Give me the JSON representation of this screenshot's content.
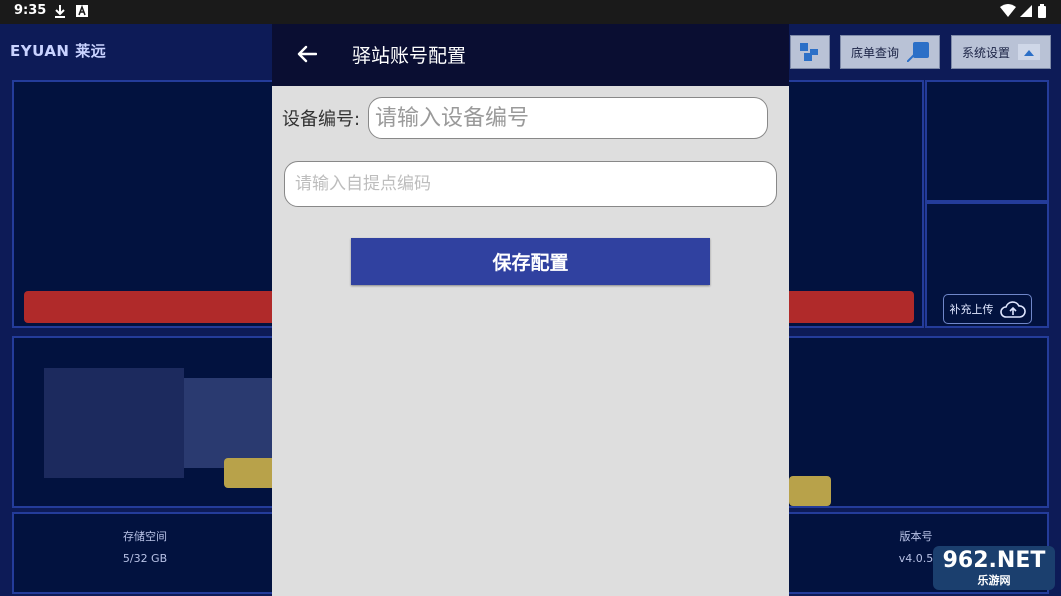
{
  "status_bar": {
    "time": "9:35",
    "icons": [
      "download-icon",
      "a-badge-icon",
      "wifi-icon",
      "signal-icon",
      "battery-icon"
    ]
  },
  "app": {
    "logo_text": "EYUAN 莱远",
    "top_buttons": [
      {
        "label": "",
        "icon": "grid-icon"
      },
      {
        "label": "底单查询",
        "icon": "query-icon"
      },
      {
        "label": "系统设置",
        "icon": "settings-icon"
      }
    ],
    "upload_label": "补充上传",
    "stats": [
      {
        "label": "存储空间",
        "value": "5/32 GB"
      },
      {
        "label": "版本号",
        "value": "v4.0.5"
      }
    ],
    "watermark": {
      "top": "962.NET",
      "bottom": "乐游网"
    }
  },
  "modal": {
    "title": "驿站账号配置",
    "device_label": "设备编号:",
    "device_placeholder": "请输入设备编号",
    "pickup_placeholder": "请输入自提点编码",
    "save_label": "保存配置"
  },
  "colors": {
    "modal_header": "#0a0e32",
    "save_button": "#3041a0",
    "modal_body": "#dedede",
    "app_background": "#0d1b57"
  }
}
